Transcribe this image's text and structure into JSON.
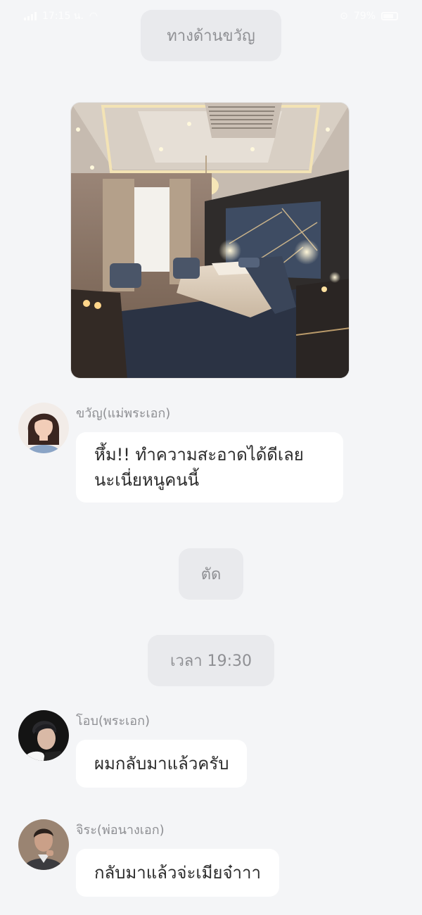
{
  "status_bar": {
    "time": "17:15 น.",
    "battery": "79%"
  },
  "chat": {
    "top_notice": "ทางด้านขวัญ",
    "cut_notice": "ตัด",
    "time_notice": "เวลา 19:30",
    "messages": [
      {
        "sender": "ขวัญ(แม่พระเอก)",
        "text_line1": "หึ้ม!! ทำความสะอาดได้ดีเลย",
        "text_line2": "นะเนี่ยหนูคนนี้"
      },
      {
        "sender": "โอบ(พระเอก)",
        "text": "ผมกลับมาแล้วครับ"
      },
      {
        "sender": "จิระ(พ่อนางเอก)",
        "text": "กลับมาแล้วจ่ะเมียจ๋าาา"
      }
    ]
  },
  "colors": {
    "background": "#f4f5f7",
    "pill": "#e9eaed",
    "bubble": "#ffffff",
    "muted_text": "#8e8f93"
  },
  "icons": [
    "signal-icon",
    "wifi-icon",
    "alarm-icon",
    "battery-icon"
  ]
}
